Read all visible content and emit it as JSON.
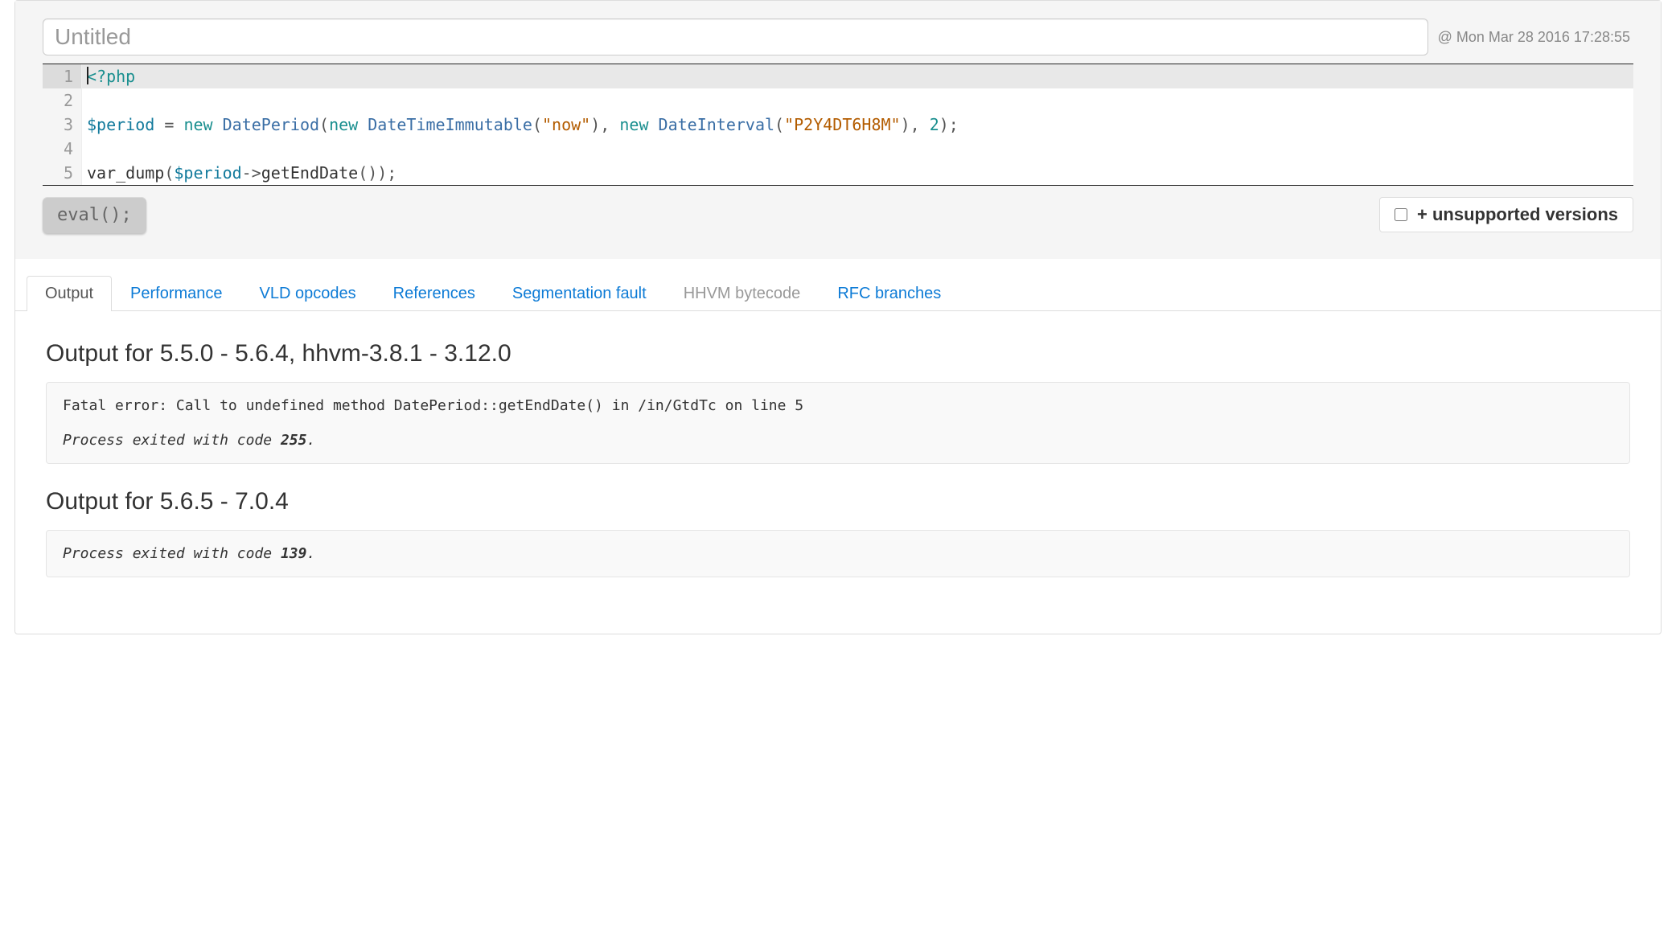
{
  "header": {
    "title_placeholder": "Untitled",
    "title_value": "",
    "timestamp": "@ Mon Mar 28 2016 17:28:55"
  },
  "editor": {
    "line_numbers": [
      "1",
      "2",
      "3",
      "4",
      "5"
    ],
    "lines_plain": [
      "<?php",
      "",
      "$period = new DatePeriod(new DateTimeImmutable(\"now\"), new DateInterval(\"P2Y4DT6H8M\"), 2);",
      "",
      "var_dump($period->getEndDate());"
    ]
  },
  "actions": {
    "eval_label": "eval();",
    "unsupported_label": "+ unsupported versions",
    "unsupported_checked": false
  },
  "tabs": [
    {
      "label": "Output",
      "state": "active"
    },
    {
      "label": "Performance",
      "state": "link"
    },
    {
      "label": "VLD opcodes",
      "state": "link"
    },
    {
      "label": "References",
      "state": "link"
    },
    {
      "label": "Segmentation fault",
      "state": "link"
    },
    {
      "label": "HHVM bytecode",
      "state": "disabled"
    },
    {
      "label": "RFC branches",
      "state": "link"
    }
  ],
  "outputs": [
    {
      "heading": "Output for 5.5.0 - 5.6.4, hhvm-3.8.1 - 3.12.0",
      "error": "Fatal error: Call to undefined method DatePeriod::getEndDate() in /in/GtdTc on line 5",
      "exit_prefix": "Process exited with code ",
      "exit_code": "255",
      "exit_suffix": "."
    },
    {
      "heading": "Output for 5.6.5 - 7.0.4",
      "error": "",
      "exit_prefix": "Process exited with code ",
      "exit_code": "139",
      "exit_suffix": "."
    }
  ]
}
